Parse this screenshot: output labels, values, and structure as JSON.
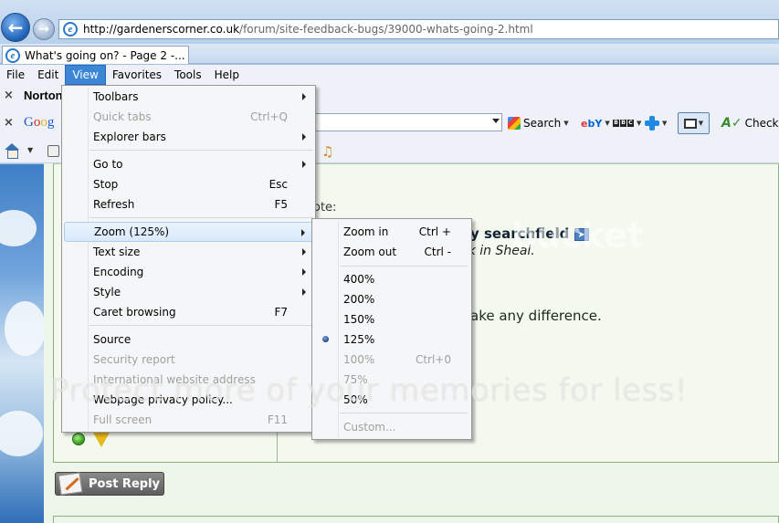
{
  "browser": {
    "url_host": "http://gardenerscorner.co.uk",
    "url_path": "/forum/site-feedback-bugs/39000-whats-going-2.html",
    "tab_title": "What's going on? - Page 2 -..."
  },
  "menubar": {
    "items": [
      "File",
      "Edit",
      "View",
      "Favorites",
      "Tools",
      "Help"
    ]
  },
  "toolbars": {
    "norton_label": "Norton",
    "google_label": "Google",
    "search_label": "Search",
    "check_label": "Check"
  },
  "view_menu": {
    "items": [
      {
        "label": "Toolbars",
        "shortcut": "",
        "submenu": true,
        "disabled": false
      },
      {
        "label": "Quick tabs",
        "shortcut": "Ctrl+Q",
        "submenu": false,
        "disabled": true
      },
      {
        "label": "Explorer bars",
        "shortcut": "",
        "submenu": true,
        "disabled": false
      },
      {
        "label": "Go to",
        "shortcut": "",
        "submenu": true,
        "disabled": false
      },
      {
        "label": "Stop",
        "shortcut": "Esc",
        "submenu": false,
        "disabled": false
      },
      {
        "label": "Refresh",
        "shortcut": "F5",
        "submenu": false,
        "disabled": false
      },
      {
        "label": "Zoom (125%)",
        "shortcut": "",
        "submenu": true,
        "disabled": false,
        "highlighted": true
      },
      {
        "label": "Text size",
        "shortcut": "",
        "submenu": true,
        "disabled": false
      },
      {
        "label": "Encoding",
        "shortcut": "",
        "submenu": true,
        "disabled": false
      },
      {
        "label": "Style",
        "shortcut": "",
        "submenu": true,
        "disabled": false
      },
      {
        "label": "Caret browsing",
        "shortcut": "F7",
        "submenu": false,
        "disabled": false
      },
      {
        "label": "Source",
        "shortcut": "",
        "submenu": false,
        "disabled": false
      },
      {
        "label": "Security report",
        "shortcut": "",
        "submenu": false,
        "disabled": true
      },
      {
        "label": "International website address",
        "shortcut": "",
        "submenu": false,
        "disabled": true
      },
      {
        "label": "Webpage privacy policy...",
        "shortcut": "",
        "submenu": false,
        "disabled": false
      },
      {
        "label": "Full screen",
        "shortcut": "F11",
        "submenu": false,
        "disabled": true
      }
    ]
  },
  "zoom_menu": {
    "items": [
      {
        "label": "Zoom in",
        "shortcut": "Ctrl +",
        "disabled": false
      },
      {
        "label": "Zoom out",
        "shortcut": "Ctrl -",
        "disabled": false
      },
      {
        "label": "400%",
        "shortcut": "",
        "disabled": false
      },
      {
        "label": "200%",
        "shortcut": "",
        "disabled": false
      },
      {
        "label": "150%",
        "shortcut": "",
        "disabled": false
      },
      {
        "label": "125%",
        "shortcut": "",
        "disabled": false,
        "selected": true
      },
      {
        "label": "100%",
        "shortcut": "Ctrl+0",
        "disabled": true
      },
      {
        "label": "75%",
        "shortcut": "",
        "disabled": true
      },
      {
        "label": "50%",
        "shortcut": "",
        "disabled": false
      },
      {
        "label": "Custom...",
        "shortcut": "",
        "disabled": true
      }
    ]
  },
  "page": {
    "quote_label": "ote:",
    "quote_title": "y searchfield",
    "quote_sub": "ck in Sheal.",
    "post_body": "ake any difference.",
    "post_reply_label": "Post Reply"
  },
  "watermark": {
    "text": "Protect more of your memories for less!",
    "logo_text": "bucket"
  },
  "colors": {
    "menu_highlight": "#d9e9fb",
    "menu_active": "#3c86d6",
    "page_bg": "#eef6ea"
  }
}
